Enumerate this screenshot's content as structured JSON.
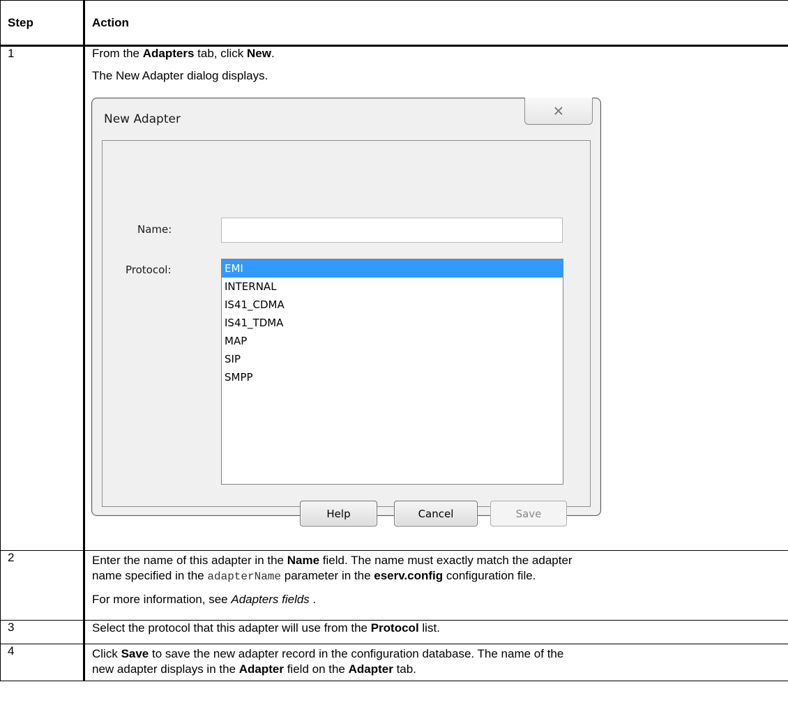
{
  "table": {
    "header": {
      "step": "Step",
      "action": "Action"
    },
    "rows": [
      {
        "step": "1",
        "line1": {
          "pre": "From the ",
          "b1": "Adapters",
          "mid": " tab, click ",
          "b2": "New",
          "post": "."
        },
        "line2": "The New Adapter dialog displays."
      },
      {
        "step": "2",
        "line1": {
          "pre": "Enter the name of this adapter in the ",
          "b1": "Name",
          "post": " field. The name must exactly match the adapter"
        },
        "line2": {
          "pre": "name specified in the ",
          "code": "adapterName",
          "mid": " parameter in the ",
          "b1": "eserv.config",
          "post": " configuration file."
        },
        "line3": {
          "pre": "For more information, see ",
          "italic": "Adapters fields",
          "post": " ."
        }
      },
      {
        "step": "3",
        "line1": {
          "pre": "Select the protocol that this adapter will use from the ",
          "b1": "Protocol",
          "post": " list."
        }
      },
      {
        "step": "4",
        "line1": {
          "pre": "Click ",
          "b1": "Save",
          "post": " to save the new adapter record in the configuration database. The name of the"
        },
        "line2": {
          "pre": "new adapter displays in the ",
          "b1": "Adapter",
          "mid": " field on the ",
          "b2": "Adapter",
          "post": " tab."
        }
      }
    ]
  },
  "dialog": {
    "title": "New Adapter",
    "close_icon": "close-icon",
    "name_label": "Name:",
    "name_value": "",
    "protocol_label": "Protocol:",
    "protocols": [
      "EMI",
      "INTERNAL",
      "IS41_CDMA",
      "IS41_TDMA",
      "MAP",
      "SIP",
      "SMPP"
    ],
    "selected_protocol": "EMI",
    "buttons": {
      "help": "Help",
      "cancel": "Cancel",
      "save": "Save"
    },
    "colors": {
      "selection": "#3399ff"
    }
  }
}
